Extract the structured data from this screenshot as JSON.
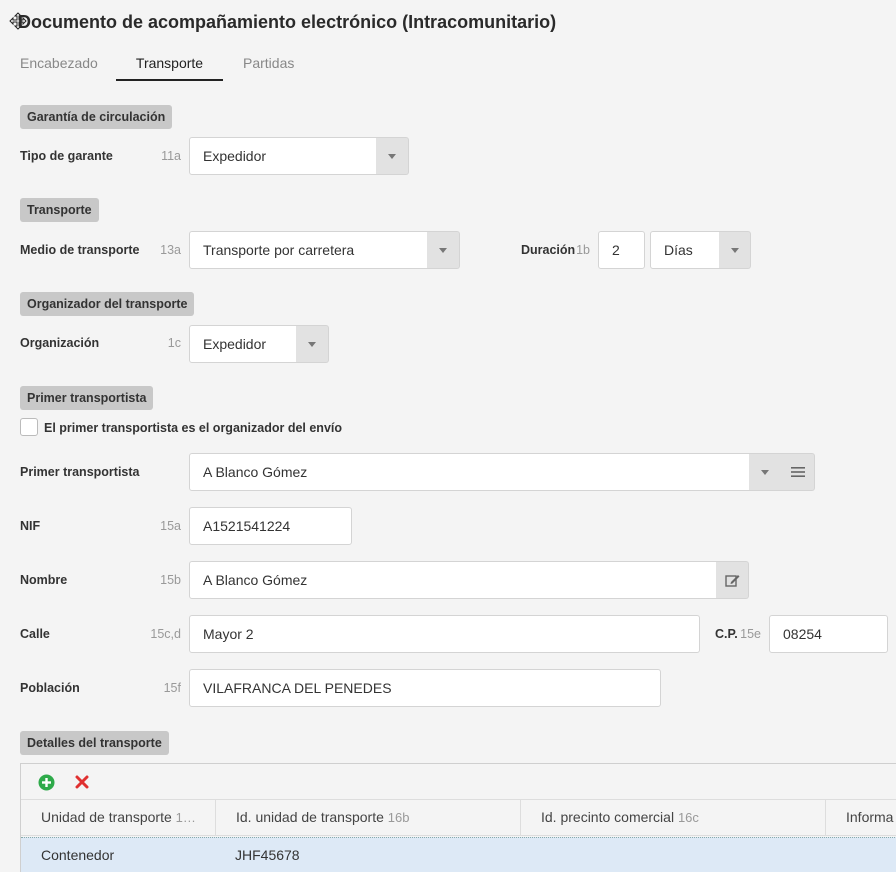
{
  "title": "Documento de acompañamiento electrónico (Intracomunitario)",
  "tabs": [
    {
      "label": "Encabezado"
    },
    {
      "label": "Transporte"
    },
    {
      "label": "Partidas"
    }
  ],
  "sections": {
    "garantia": "Garantía de circulación",
    "transporte": "Transporte",
    "organizador": "Organizador del transporte",
    "primer": "Primer transportista",
    "detalles": "Detalles del transporte"
  },
  "fields": {
    "tipo_garante": {
      "label": "Tipo de garante",
      "code": "11a",
      "value": "Expedidor"
    },
    "medio_transporte": {
      "label": "Medio de transporte",
      "code": "13a",
      "value": "Transporte por carretera"
    },
    "duracion": {
      "label": "Duración",
      "code": "1b",
      "value": "2",
      "unit": "Días"
    },
    "organizacion": {
      "label": "Organización",
      "code": "1c",
      "value": "Expedidor"
    },
    "es_organizador": {
      "label": "El primer transportista es el organizador del envío",
      "checked": false
    },
    "primer_transportista": {
      "label": "Primer transportista",
      "value": "A Blanco Gómez"
    },
    "nif": {
      "label": "NIF",
      "code": "15a",
      "value": "A1521541224"
    },
    "nombre": {
      "label": "Nombre",
      "code": "15b",
      "value": "A Blanco Gómez"
    },
    "calle": {
      "label": "Calle",
      "code": "15c,d",
      "value": "Mayor 2"
    },
    "cp": {
      "label": "C.P.",
      "code": "15e",
      "value": "08254"
    },
    "poblacion": {
      "label": "Población",
      "code": "15f",
      "value": "VILAFRANCA DEL PENEDES"
    }
  },
  "grid": {
    "columns": [
      {
        "label": "Unidad de transporte",
        "code": "1…"
      },
      {
        "label": "Id. unidad de transporte",
        "code": "16b"
      },
      {
        "label": "Id. precinto comercial",
        "code": "16c"
      },
      {
        "label": "Informa",
        "code": ""
      }
    ],
    "rows": [
      [
        "Contenedor",
        "JHF45678",
        "",
        ""
      ]
    ]
  },
  "colors": {
    "accent_add": "#2eaa4a",
    "accent_delete": "#e03030",
    "section_bg": "#c8c8c8",
    "selected_row": "#dde9f6"
  }
}
